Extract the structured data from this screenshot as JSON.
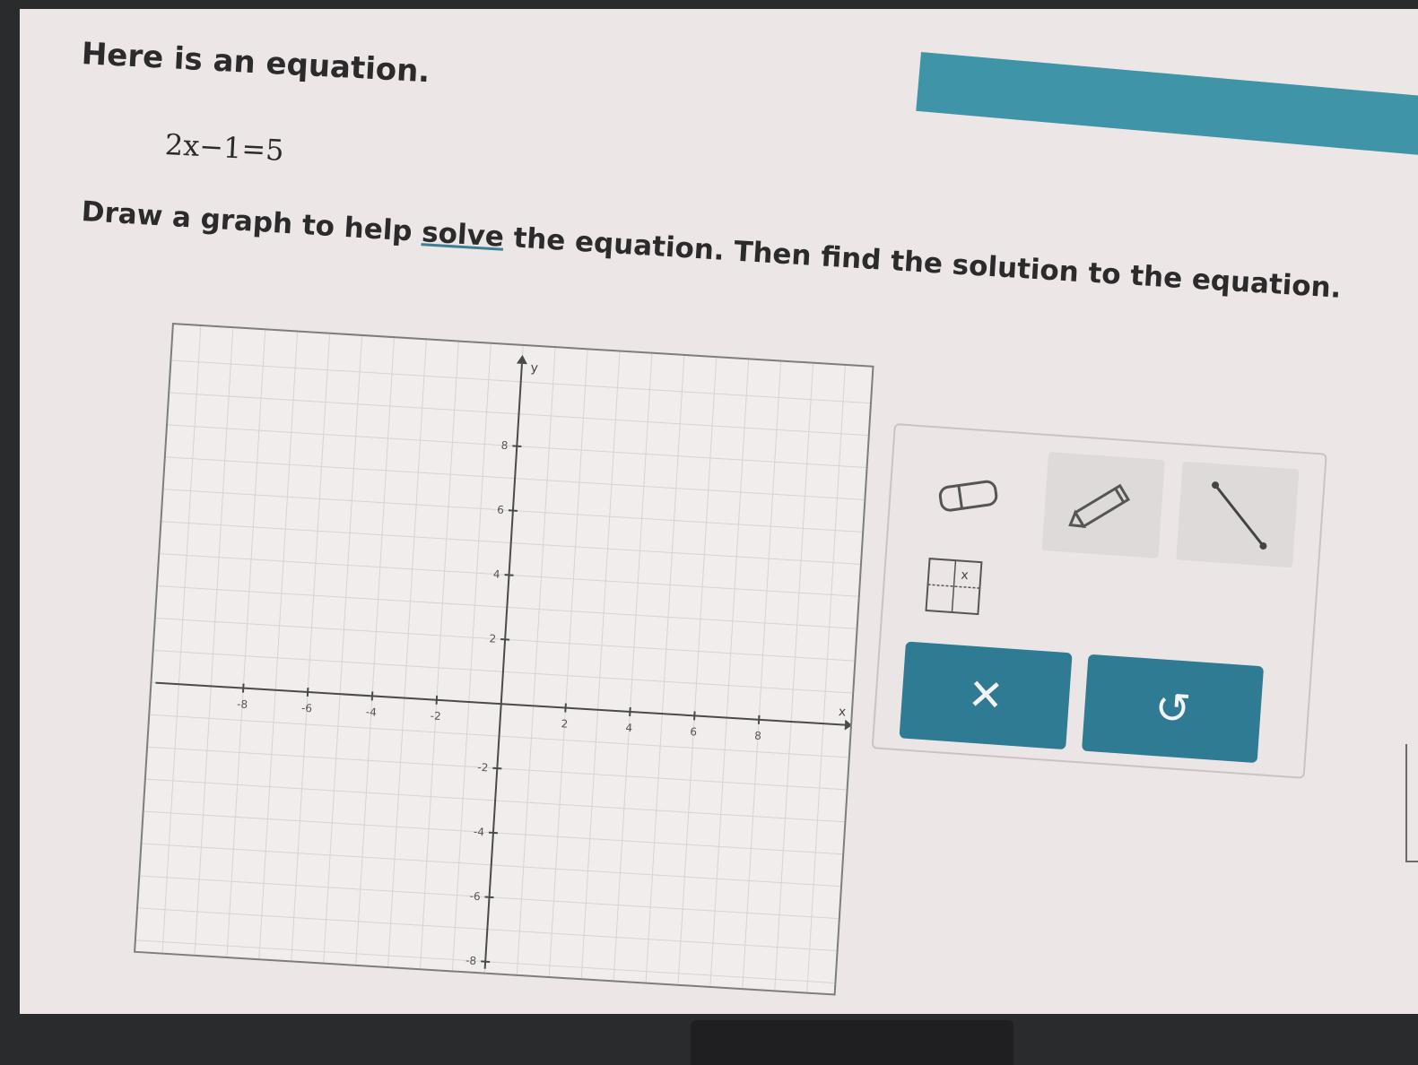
{
  "prompt": {
    "intro": "Here is an equation.",
    "equation": "2x−1=5",
    "instruction_pre": "Draw a graph to help ",
    "instruction_link": "solve",
    "instruction_post": " the equation. Then find the solution to the equation."
  },
  "graph": {
    "x_axis_label": "x",
    "y_axis_label": "y",
    "x_range": [
      -10,
      10
    ],
    "y_range": [
      -10,
      10
    ],
    "x_ticks": [
      {
        "value": -8,
        "label": "-8"
      },
      {
        "value": -6,
        "label": "-6"
      },
      {
        "value": -4,
        "label": "-4"
      },
      {
        "value": -2,
        "label": "-2"
      },
      {
        "value": 2,
        "label": "2"
      },
      {
        "value": 4,
        "label": "4"
      },
      {
        "value": 6,
        "label": "6"
      },
      {
        "value": 8,
        "label": "8"
      }
    ],
    "y_ticks": [
      {
        "value": 8,
        "label": "8"
      },
      {
        "value": 6,
        "label": "6"
      },
      {
        "value": 4,
        "label": "4"
      },
      {
        "value": 2,
        "label": "2"
      },
      {
        "value": -2,
        "label": "-2"
      },
      {
        "value": -4,
        "label": "-4"
      },
      {
        "value": -6,
        "label": "-6"
      },
      {
        "value": -8,
        "label": "-8"
      }
    ],
    "grid": true
  },
  "tools": {
    "eraser": "eraser-icon",
    "pencil": "pencil-icon",
    "line": "line-segment-icon",
    "point": "point-plot-icon",
    "point_label": "x",
    "clear_symbol": "✕",
    "undo_symbol": "↺"
  },
  "colors": {
    "accent": "#2f7b93",
    "header_bar": "#3f95a7",
    "link_underline": "#3f7f95"
  }
}
